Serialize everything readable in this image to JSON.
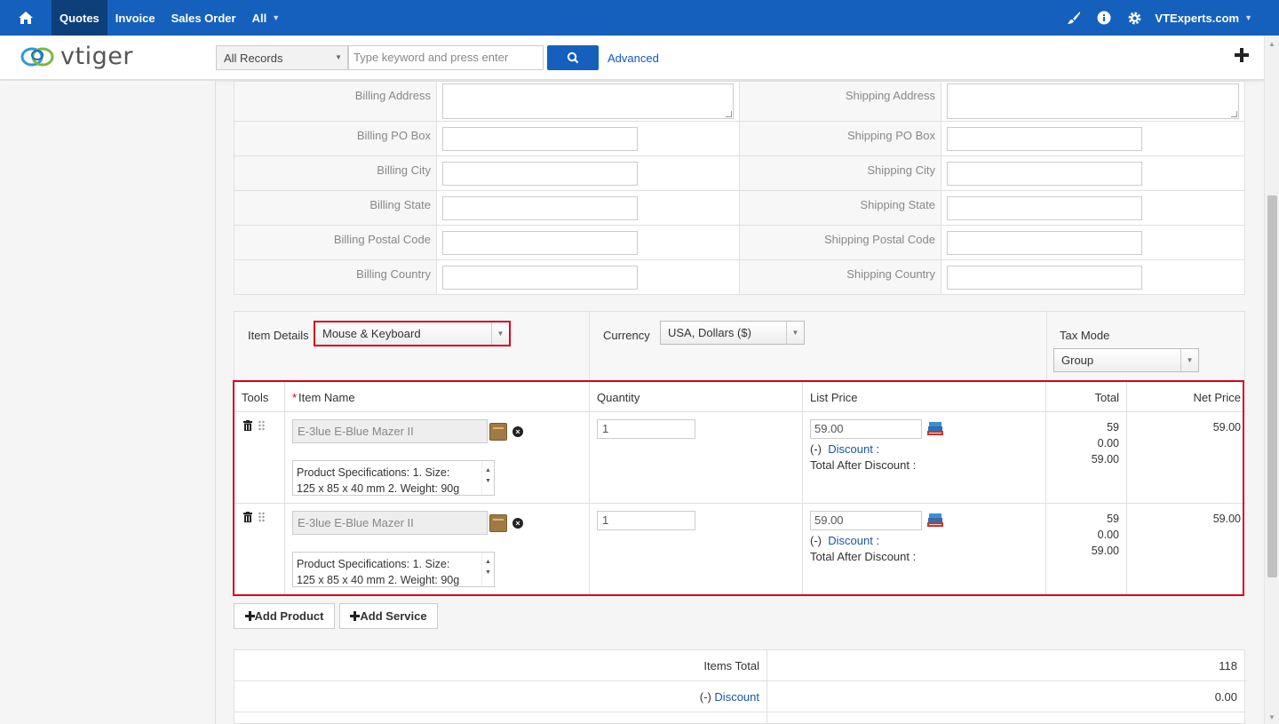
{
  "topnav": {
    "items": [
      {
        "label": "Quotes",
        "active": true
      },
      {
        "label": "Invoice"
      },
      {
        "label": "Sales Order"
      },
      {
        "label": "All"
      }
    ],
    "user": "VTExperts.com",
    "icons": [
      "home-icon",
      "brush-icon",
      "info-icon",
      "gear-icon"
    ]
  },
  "header": {
    "logo": "vtiger",
    "records_select": "All Records",
    "search_placeholder": "Type keyword and press enter",
    "advanced": "Advanced"
  },
  "address": {
    "rows": [
      {
        "left": "Billing Address",
        "right": "Shipping Address"
      },
      {
        "left": "Billing PO Box",
        "right": "Shipping PO Box"
      },
      {
        "left": "Billing City",
        "right": "Shipping City"
      },
      {
        "left": "Billing State",
        "right": "Shipping State"
      },
      {
        "left": "Billing Postal Code",
        "right": "Shipping Postal Code"
      },
      {
        "left": "Billing Country",
        "right": "Shipping Country"
      }
    ]
  },
  "item_details": {
    "label": "Item Details",
    "value": "Mouse & Keyboard",
    "currency_label": "Currency",
    "currency_value": "USA, Dollars ($)",
    "taxmode_label": "Tax Mode",
    "taxmode_value": "Group"
  },
  "columns": {
    "tools": "Tools",
    "item_required": "*",
    "item_name": "Item Name",
    "quantity": "Quantity",
    "list_price": "List Price",
    "total": "Total",
    "net_price": "Net Price"
  },
  "line_items": [
    {
      "name": "E-3lue E-Blue Mazer II",
      "desc_line1": "Product Specifications: 1. Size:",
      "desc_line2": "125 x 85 x 40 mm 2. Weight: 90g",
      "qty": "1",
      "list_price": "59.00",
      "discount_prefix": "(-)",
      "discount_label": "Discount",
      "discount_colon": ":",
      "after_discount_label": "Total After Discount :",
      "total": "59",
      "discount_value": "0.00",
      "after_discount": "59.00",
      "net_price": "59.00"
    },
    {
      "name": "E-3lue E-Blue Mazer II",
      "desc_line1": "Product Specifications: 1. Size:",
      "desc_line2": "125 x 85 x 40 mm 2. Weight: 90g",
      "qty": "1",
      "list_price": "59.00",
      "discount_prefix": "(-)",
      "discount_label": "Discount",
      "discount_colon": ":",
      "after_discount_label": "Total After Discount :",
      "total": "59",
      "discount_value": "0.00",
      "after_discount": "59.00",
      "net_price": "59.00"
    }
  ],
  "buttons": {
    "add_product": "Add Product",
    "add_service": "Add Service"
  },
  "totals": {
    "items_total_label": "Items Total",
    "items_total_value": "118",
    "discount_prefix": "(-)",
    "discount_label": "Discount",
    "discount_value": "0.00"
  },
  "colors": {
    "brand": "#1560bd",
    "highlight": "#d9001b",
    "link": "#1a57a5"
  }
}
